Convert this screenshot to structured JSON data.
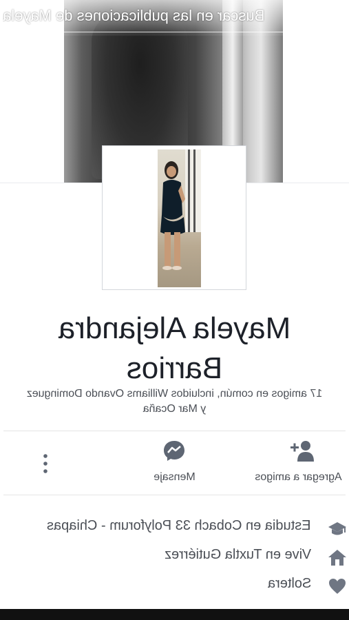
{
  "search": {
    "text": "Buscar en las publicaciones de Mayela"
  },
  "profile": {
    "name_line1": "Mayela Alejandra",
    "name_line2": "Barrios",
    "mutual_line1": "17 amigos en común, incluidos Williams Ovando Dominguez",
    "mutual_line2": "y Mar Ocaña"
  },
  "actions": [
    {
      "label": "Agregar a amigos",
      "icon": "add-friend-icon"
    },
    {
      "label": "Mensaje",
      "icon": "messenger-icon"
    },
    {
      "label": "",
      "icon": "more-icon"
    }
  ],
  "info": [
    {
      "text": "Estudia en Cobach 33 Polyforum - Chiapas",
      "icon": "graduation-cap-icon"
    },
    {
      "text": "Vive en Tuxtla Gutiérrez",
      "icon": "home-icon"
    },
    {
      "text": "Soltera",
      "icon": "heart-icon"
    }
  ],
  "colors": {
    "text_primary": "#1d2129",
    "text_secondary": "#4b4f56",
    "icon_gray": "#5e6673",
    "divider": "#e5e5e5"
  }
}
